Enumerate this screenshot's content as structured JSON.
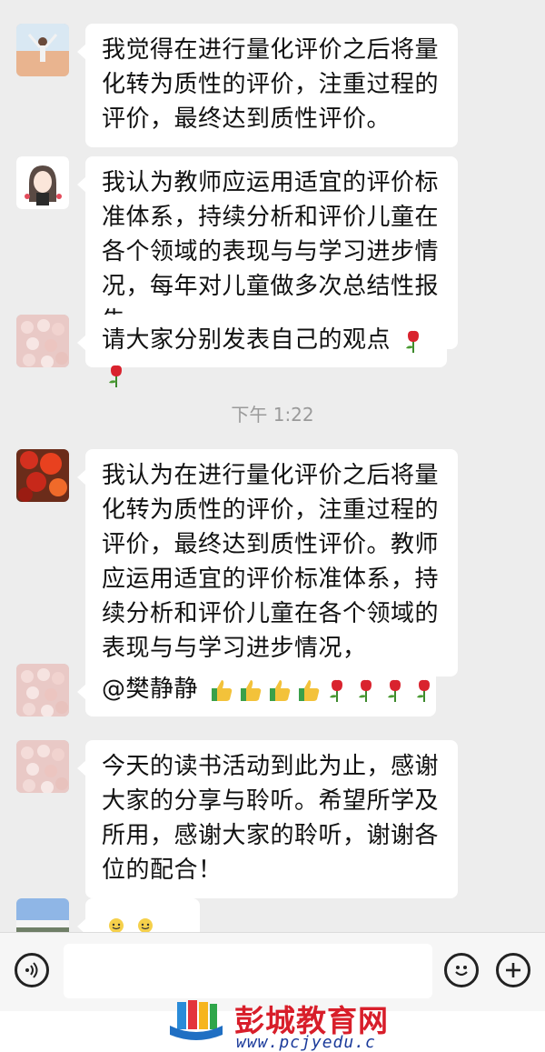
{
  "messages": [
    {
      "text": "我觉得在进行量化评价之后将量化转为质性的评价，注重过程的评价，最终达到质性评价。"
    },
    {
      "text": "我认为教师应运用适宜的评价标准体系，持续分析和评价儿童在各个领域的表现与与学习进步情况，每年对儿童做多次总结性报告"
    },
    {
      "text": "请大家分别发表自己的观点"
    },
    {
      "text": "我认为在进行量化评价之后将量化转为质性的评价，注重过程的评价，最终达到质性评价。教师应运用适宜的评价标准体系，持续分析和评价儿童在各个领域的表现与与学习进步情况，"
    },
    {
      "text": "@樊静静"
    },
    {
      "text": "今天的读书活动到此为止，感谢大家的分享与聆听。希望所学及所用，感谢大家的聆听，谢谢各位的配合！"
    },
    {
      "text": ""
    }
  ],
  "timestamp": "下午 1:22",
  "icons": {
    "rose": "rose-emoji",
    "thumbs_up": "thumbs-up-emoji",
    "bean_person": "smiley-bean-emoji",
    "voice": "voice-icon",
    "emoji": "emoji-icon",
    "plus": "plus-icon"
  },
  "watermark": {
    "name": "彭城教育网",
    "url": "www.pcjyedu.c"
  }
}
